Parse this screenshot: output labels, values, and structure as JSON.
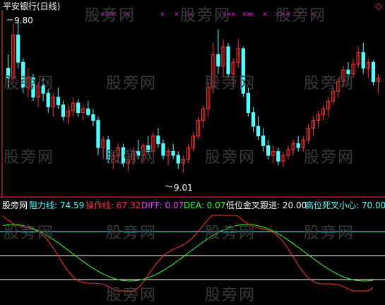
{
  "title": "平安银行(日线)",
  "colors": {
    "background": "#000000",
    "up_candle": "#ff3232",
    "down_candle": "#54ffff",
    "marker": "#ff00ff",
    "resistance_line": "#54ffff",
    "operation_line": "#ff3232",
    "diff": "#e040fb",
    "dea": "#32ff32",
    "white": "#ffffff",
    "panel_border": "#ff3232"
  },
  "price_panel": {
    "high_label": "9.80",
    "low_label": "9.01",
    "markers": [
      "×",
      "×",
      "×",
      "×",
      "×",
      "×",
      "×",
      "×",
      "×",
      "×",
      "×",
      "×",
      "×",
      "×",
      "×",
      "×",
      "×",
      "×",
      "×",
      "×"
    ]
  },
  "watermark": "股旁网",
  "indicator": {
    "name": "股旁网",
    "resist_label": "阻力线:",
    "resist_value": "74.59",
    "op_label": "操作线:",
    "op_value": "67.32",
    "diff_label": "DIFF:",
    "diff_value": "0.07",
    "dea_label": "DEA:",
    "dea_value": "0.07",
    "low_cross_label": "低位金叉跟进:",
    "low_cross_value": "20.00",
    "high_cross_label": "高位死叉小心:",
    "high_cross_value": "70.00"
  },
  "corner_icon": "◇",
  "chart_data": {
    "type": "candlestick",
    "price_range": [
      8.9,
      9.85
    ],
    "candles": [
      [
        9.55,
        9.62,
        9.45,
        9.5
      ],
      [
        9.5,
        9.78,
        9.48,
        9.72
      ],
      [
        9.72,
        9.8,
        9.55,
        9.58
      ],
      [
        9.58,
        9.6,
        9.42,
        9.45
      ],
      [
        9.45,
        9.55,
        9.4,
        9.5
      ],
      [
        9.5,
        9.52,
        9.38,
        9.4
      ],
      [
        9.4,
        9.48,
        9.35,
        9.46
      ],
      [
        9.46,
        9.5,
        9.38,
        9.42
      ],
      [
        9.42,
        9.44,
        9.32,
        9.35
      ],
      [
        9.35,
        9.42,
        9.3,
        9.4
      ],
      [
        9.4,
        9.45,
        9.34,
        9.36
      ],
      [
        9.36,
        9.38,
        9.28,
        9.3
      ],
      [
        9.3,
        9.36,
        9.26,
        9.33
      ],
      [
        9.33,
        9.4,
        9.3,
        9.37
      ],
      [
        9.37,
        9.39,
        9.3,
        9.32
      ],
      [
        9.32,
        9.36,
        9.28,
        9.34
      ],
      [
        9.34,
        9.38,
        9.3,
        9.31
      ],
      [
        9.31,
        9.34,
        9.25,
        9.28
      ],
      [
        9.28,
        9.3,
        9.1,
        9.14
      ],
      [
        9.14,
        9.2,
        9.08,
        9.18
      ],
      [
        9.18,
        9.2,
        9.06,
        9.08
      ],
      [
        9.08,
        9.12,
        9.03,
        9.1
      ],
      [
        9.1,
        9.16,
        9.06,
        9.14
      ],
      [
        9.14,
        9.16,
        9.04,
        9.06
      ],
      [
        9.06,
        9.1,
        9.02,
        9.08
      ],
      [
        9.08,
        9.14,
        9.05,
        9.12
      ],
      [
        9.12,
        9.18,
        9.08,
        9.1
      ],
      [
        9.1,
        9.16,
        9.06,
        9.15
      ],
      [
        9.15,
        9.2,
        9.1,
        9.12
      ],
      [
        9.12,
        9.22,
        9.1,
        9.2
      ],
      [
        9.2,
        9.24,
        9.14,
        9.16
      ],
      [
        9.16,
        9.18,
        9.08,
        9.1
      ],
      [
        9.1,
        9.14,
        9.05,
        9.12
      ],
      [
        9.12,
        9.16,
        9.08,
        9.1
      ],
      [
        9.1,
        9.12,
        9.03,
        9.06
      ],
      [
        9.06,
        9.1,
        9.01,
        9.08
      ],
      [
        9.08,
        9.16,
        9.06,
        9.14
      ],
      [
        9.14,
        9.22,
        9.12,
        9.2
      ],
      [
        9.2,
        9.3,
        9.18,
        9.28
      ],
      [
        9.28,
        9.36,
        9.24,
        9.34
      ],
      [
        9.34,
        9.48,
        9.3,
        9.45
      ],
      [
        9.45,
        9.68,
        9.42,
        9.62
      ],
      [
        9.62,
        9.75,
        9.52,
        9.56
      ],
      [
        9.56,
        9.7,
        9.5,
        9.66
      ],
      [
        9.66,
        9.68,
        9.5,
        9.52
      ],
      [
        9.52,
        9.6,
        9.45,
        9.58
      ],
      [
        9.58,
        9.7,
        9.55,
        9.65
      ],
      [
        9.65,
        9.66,
        9.4,
        9.42
      ],
      [
        9.42,
        9.45,
        9.3,
        9.32
      ],
      [
        9.32,
        9.35,
        9.22,
        9.25
      ],
      [
        9.25,
        9.3,
        9.18,
        9.2
      ],
      [
        9.2,
        9.24,
        9.12,
        9.15
      ],
      [
        9.15,
        9.18,
        9.08,
        9.1
      ],
      [
        9.1,
        9.15,
        9.06,
        9.12
      ],
      [
        9.12,
        9.14,
        9.05,
        9.07
      ],
      [
        9.07,
        9.12,
        9.04,
        9.1
      ],
      [
        9.1,
        9.15,
        9.08,
        9.13
      ],
      [
        9.13,
        9.18,
        9.1,
        9.16
      ],
      [
        9.16,
        9.2,
        9.12,
        9.14
      ],
      [
        9.14,
        9.2,
        9.12,
        9.18
      ],
      [
        9.18,
        9.26,
        9.16,
        9.24
      ],
      [
        9.24,
        9.3,
        9.2,
        9.28
      ],
      [
        9.28,
        9.33,
        9.24,
        9.31
      ],
      [
        9.31,
        9.36,
        9.28,
        9.34
      ],
      [
        9.34,
        9.4,
        9.3,
        9.38
      ],
      [
        9.38,
        9.45,
        9.36,
        9.43
      ],
      [
        9.43,
        9.5,
        9.4,
        9.48
      ],
      [
        9.48,
        9.56,
        9.45,
        9.54
      ],
      [
        9.54,
        9.58,
        9.48,
        9.52
      ],
      [
        9.52,
        9.6,
        9.5,
        9.57
      ],
      [
        9.57,
        9.66,
        9.55,
        9.63
      ],
      [
        9.63,
        9.68,
        9.52,
        9.55
      ],
      [
        9.55,
        9.6,
        9.5,
        9.58
      ],
      [
        9.58,
        9.59,
        9.46,
        9.48
      ],
      [
        9.48,
        9.52,
        9.42,
        9.5
      ]
    ]
  }
}
